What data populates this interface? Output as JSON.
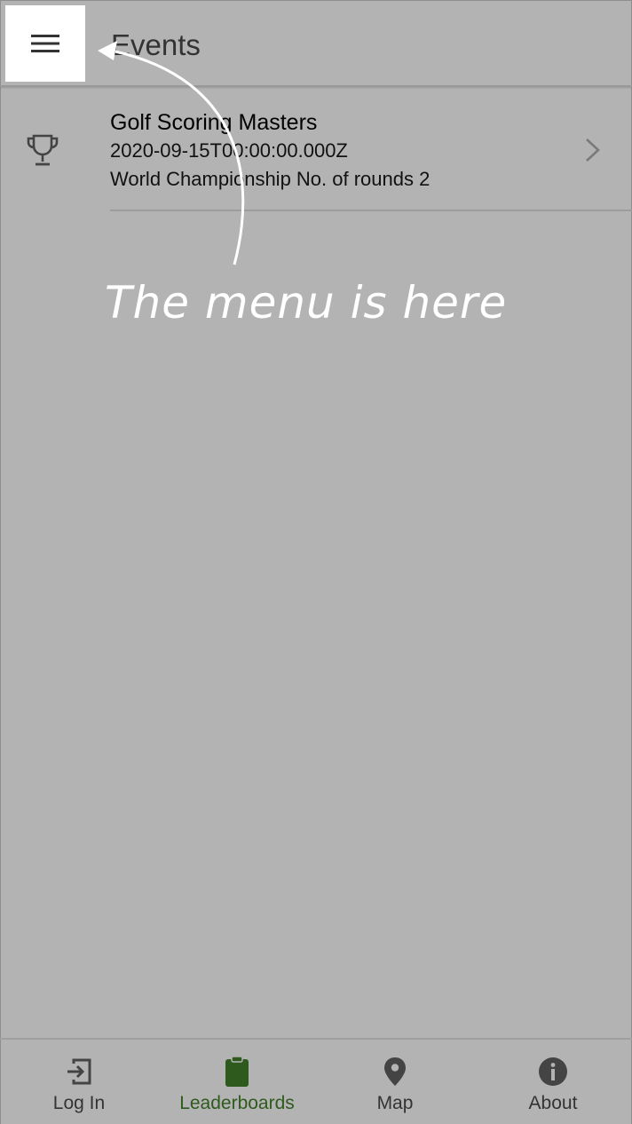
{
  "header": {
    "title": "Events",
    "menu_icon": "hamburger-menu-icon"
  },
  "events": [
    {
      "icon": "trophy-icon",
      "name": "Golf Scoring Masters",
      "date": "2020-09-15T00:00:00.000Z",
      "details": "World Championship No. of rounds 2"
    }
  ],
  "annotation": {
    "text": "The menu is here"
  },
  "tabbar": {
    "tabs": [
      {
        "label": "Log In",
        "icon": "login-icon",
        "active": false
      },
      {
        "label": "Leaderboards",
        "icon": "clipboard-icon",
        "active": true
      },
      {
        "label": "Map",
        "icon": "map-pin-icon",
        "active": false
      },
      {
        "label": "About",
        "icon": "info-icon",
        "active": false
      }
    ]
  },
  "colors": {
    "background": "#b3b3b3",
    "active_tab": "#2f5a1d",
    "highlight": "#ffffff"
  }
}
